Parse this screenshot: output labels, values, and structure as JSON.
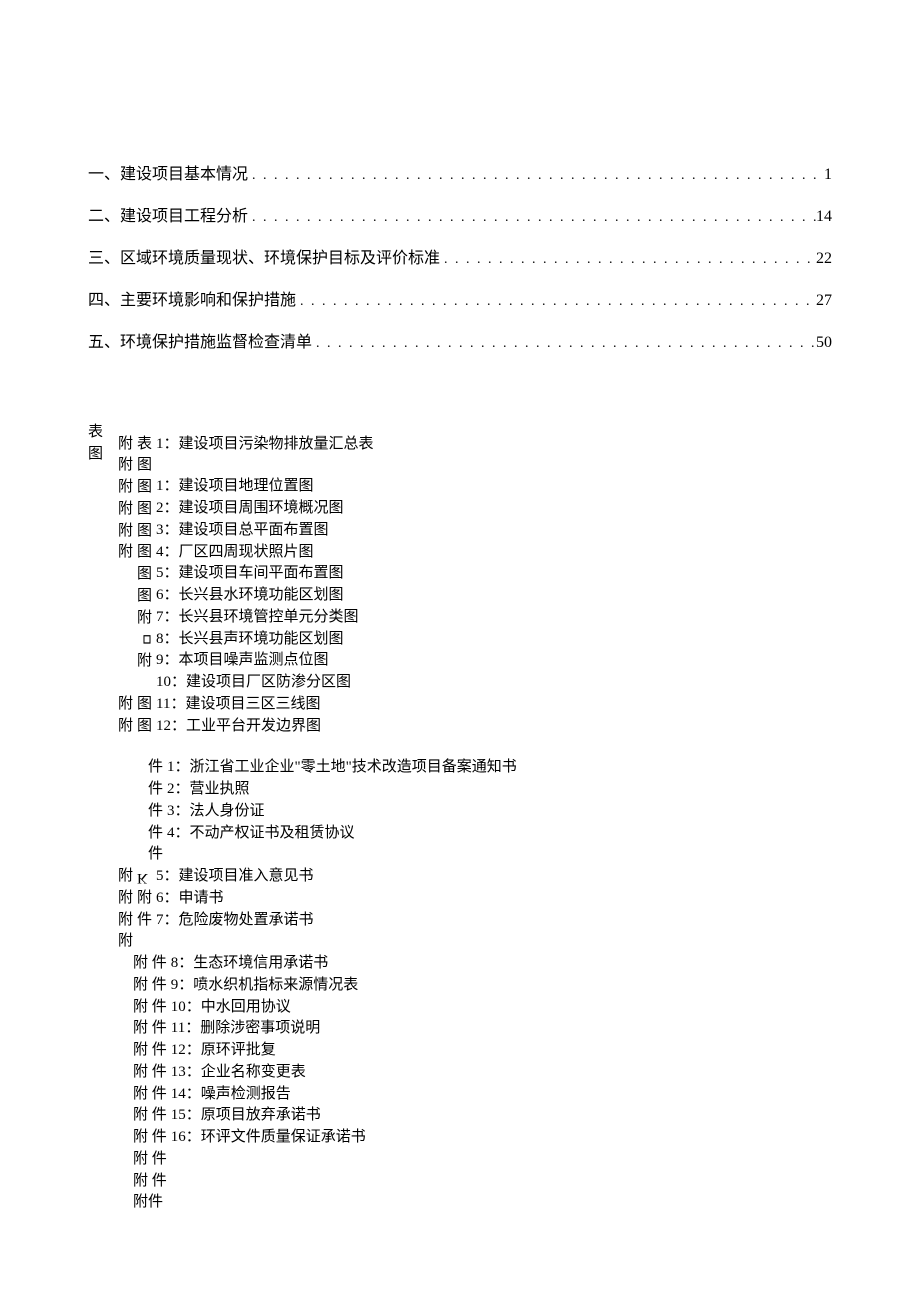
{
  "toc": [
    {
      "title": "一、建设项目基本情况",
      "page": "1"
    },
    {
      "title": "二、建设项目工程分析",
      "page": "14"
    },
    {
      "title": "三、区域环境质量现状、环境保护目标及评价标准",
      "page": "22"
    },
    {
      "title": "四、主要环境影响和保护措施",
      "page": "27"
    },
    {
      "title": "五、环境保护措施监督检查清单",
      "page": "50"
    }
  ],
  "headers": {
    "biao": "表",
    "tu": "图",
    "fu": "附",
    "jian": "件"
  },
  "tables": {
    "prefix": "附",
    "type": "表",
    "items": [
      "1：建设项目污染物排放量汇总表"
    ]
  },
  "figures": {
    "prefix": "附",
    "type": "图",
    "items": [
      "1：建设项目地理位置图",
      "2：建设项目周围环境概况图",
      "3：建设项目总平面布置图",
      "4：厂区四周现状照片图",
      "5：建设项目车间平面布置图",
      "6：长兴县水环境功能区划图",
      "7：长兴县环境管控单元分类图",
      "8：长兴县声环境功能区划图",
      "9：本项目噪声监测点位图",
      "10：建设项目厂区防渗分区图",
      "11：建设项目三区三线图",
      "12：工业平台开发边界图"
    ]
  },
  "attachments": {
    "prefix": "附",
    "type_jian": "件",
    "type_fujian": "附件",
    "items": [
      "1：浙江省工业企业\"零土地\"技术改造项目备案通知书",
      "2：营业执照",
      "3：法人身份证",
      "4：不动产权证书及租赁协议",
      "5：建设项目准入意见书",
      "6：申请书",
      "7：危险废物处置承诺书",
      "8：生态环境信用承诺书",
      "9：喷水织机指标来源情况表",
      "10：中水回用协议",
      "11：删除涉密事项说明",
      "12：原环评批复",
      "13：企业名称变更表",
      "14：噪声检测报告",
      "15：原项目放弃承诺书",
      "16：环评文件质量保证承诺书"
    ]
  }
}
